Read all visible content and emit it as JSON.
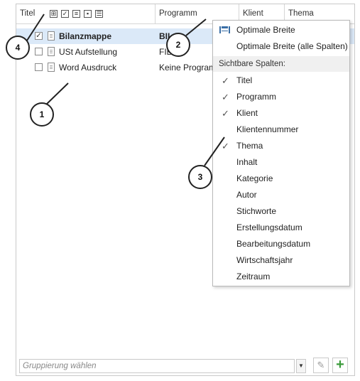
{
  "columns": {
    "titel": "Titel",
    "programm": "Programm",
    "klient": "Klient",
    "thema": "Thema"
  },
  "rows": [
    {
      "checked": true,
      "title": "Bilanzmappe",
      "program": "BIL",
      "selected": true
    },
    {
      "checked": false,
      "title": "USt Aufstellung",
      "program": "FIB",
      "selected": false
    },
    {
      "checked": false,
      "title": "Word Ausdruck",
      "program": "Keine Program",
      "selected": false
    }
  ],
  "footer": {
    "placeholder": "Gruppierung wählen"
  },
  "menu": {
    "optimal_width": "Optimale Breite",
    "optimal_width_all": "Optimale Breite (alle Spalten)",
    "section_header": "Sichtbare Spalten:",
    "check_glyph": "✓",
    "items": [
      {
        "label": "Titel",
        "checked": true
      },
      {
        "label": "Programm",
        "checked": true
      },
      {
        "label": "Klient",
        "checked": true
      },
      {
        "label": "Klientennummer",
        "checked": false
      },
      {
        "label": "Thema",
        "checked": true
      },
      {
        "label": "Inhalt",
        "checked": false
      },
      {
        "label": "Kategorie",
        "checked": false
      },
      {
        "label": "Autor",
        "checked": false
      },
      {
        "label": "Stichworte",
        "checked": false
      },
      {
        "label": "Erstellungsdatum",
        "checked": false
      },
      {
        "label": "Bearbeitungsdatum",
        "checked": false
      },
      {
        "label": "Wirtschaftsjahr",
        "checked": false
      },
      {
        "label": "Zeitraum",
        "checked": false
      }
    ]
  },
  "callouts": [
    "1",
    "2",
    "3",
    "4"
  ],
  "colors": {
    "selection": "#dbe9f8",
    "accent_green": "#3b9b3b",
    "width_icon": "#3a6ea5"
  }
}
